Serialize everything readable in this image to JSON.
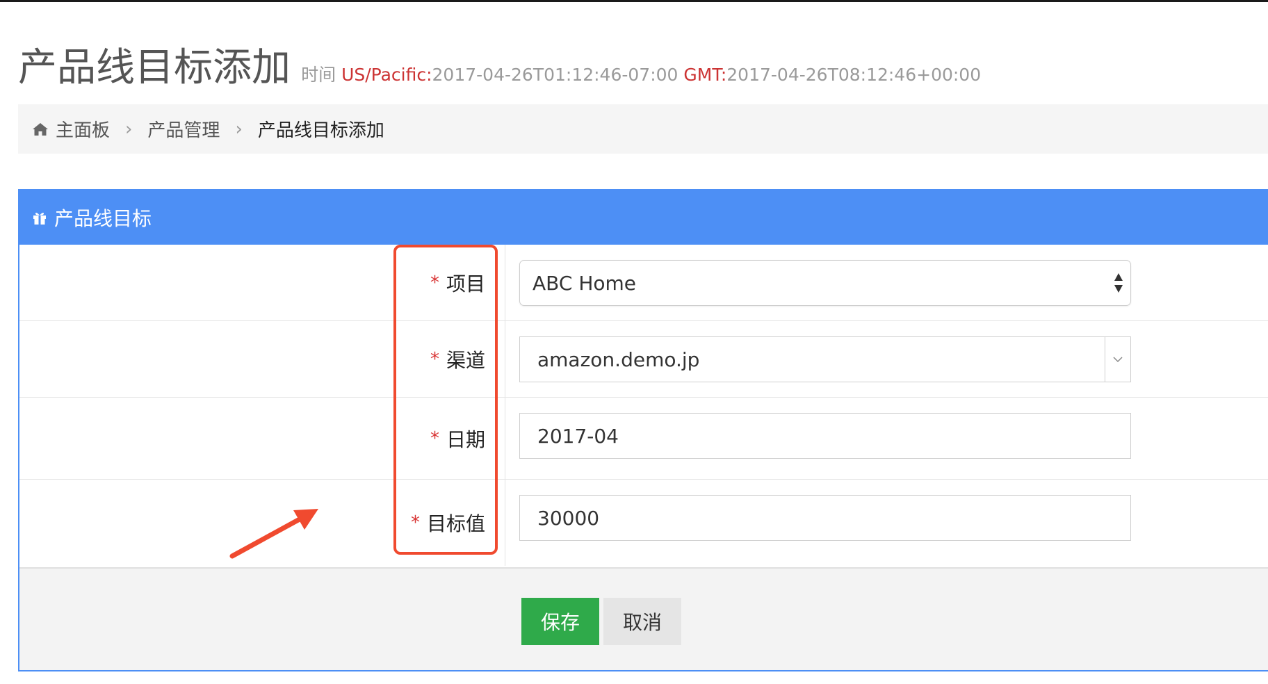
{
  "header": {
    "title": "产品线目标添加",
    "time_label": "时间",
    "tz1_name": "US/Pacific:",
    "tz1_value": "2017-04-26T01:12:46-07:00",
    "tz2_name": "GMT:",
    "tz2_value": "2017-04-26T08:12:46+00:00"
  },
  "breadcrumb": {
    "items": [
      "主面板",
      "产品管理",
      "产品线目标添加"
    ],
    "home_icon": "home-icon"
  },
  "panel": {
    "title": "产品线目标",
    "icon": "gift-icon",
    "accent_color": "#4d8ff5"
  },
  "form": {
    "fields": [
      {
        "label": "项目",
        "required": "*",
        "value": "ABC Home",
        "type": "select"
      },
      {
        "label": "渠道",
        "required": "*",
        "value": "amazon.demo.jp",
        "type": "select"
      },
      {
        "label": "日期",
        "required": "*",
        "value": "2017-04",
        "type": "input"
      },
      {
        "label": "目标值",
        "required": "*",
        "value": "30000",
        "type": "input"
      }
    ]
  },
  "actions": {
    "save_label": "保存",
    "cancel_label": "取消",
    "save_color": "#2faa4a"
  },
  "annotation_color": "#f04a2f"
}
